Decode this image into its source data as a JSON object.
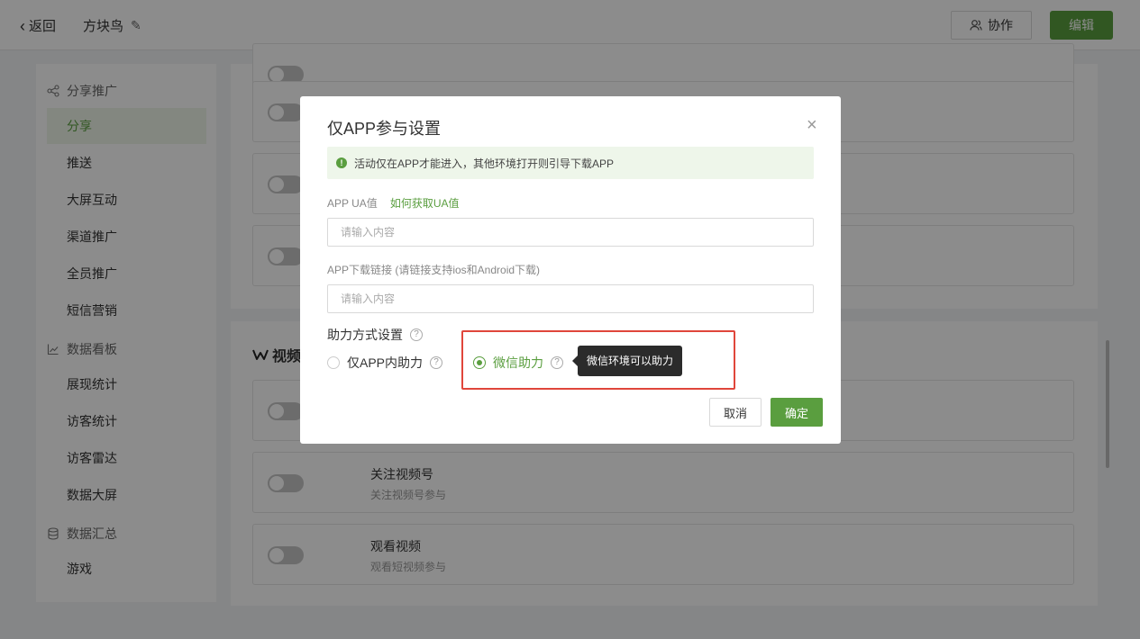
{
  "header": {
    "back_label": "返回",
    "project_title": "方块鸟",
    "collab_label": "协作",
    "edit_label": "编辑"
  },
  "sidebar": {
    "groups": [
      {
        "label": "分享推广",
        "icon": "share-icon",
        "items": [
          "分享",
          "推送",
          "大屏互动",
          "渠道推广",
          "全员推广",
          "短信营销"
        ]
      },
      {
        "label": "数据看板",
        "icon": "chart-icon",
        "items": [
          "展现统计",
          "访客统计",
          "访客雷达",
          "数据大屏"
        ]
      },
      {
        "label": "数据汇总",
        "icon": "database-icon",
        "items": [
          "游戏"
        ]
      }
    ],
    "active_item": "分享"
  },
  "main": {
    "section_title": "视频",
    "cards": [
      {
        "title": "关注视频号",
        "subtitle": "关注视频号参与"
      },
      {
        "title": "观看视频",
        "subtitle": "观看短视频参与"
      }
    ]
  },
  "modal": {
    "title": "仅APP参与设置",
    "notice": "活动仅在APP才能进入，其他环境打开则引导下载APP",
    "ua_label": "APP UA值",
    "ua_link": "如何获取UA值",
    "ua_placeholder": "请输入内容",
    "download_label": "APP下载链接 (请链接支持ios和Android下载)",
    "download_placeholder": "请输入内容",
    "assist_label": "助力方式设置",
    "options": [
      {
        "label": "仅APP内助力",
        "checked": false
      },
      {
        "label": "微信助力",
        "checked": true
      }
    ],
    "tooltip": "微信环境可以助力",
    "cancel_label": "取消",
    "confirm_label": "确定"
  },
  "colors": {
    "accent": "#5a9e3f",
    "highlight_box": "#e0463b"
  }
}
